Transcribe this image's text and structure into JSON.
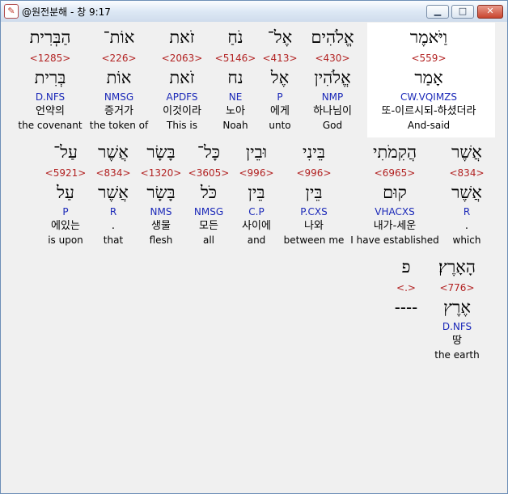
{
  "window": {
    "title": "@원전분해 - 창 9:17",
    "min": "▁",
    "max": "□",
    "close": "✕"
  },
  "rows": [
    [
      {
        "heb": "וַיֹּאמֶר",
        "strong": "<559>",
        "lemma": "אָמַר",
        "morph": "CW.VQIMZS",
        "kor": "또-이르시되-하셨더라",
        "eng": "And-said",
        "highlight": true
      },
      {
        "heb": "אֱלֹהִים",
        "strong": "<430>",
        "lemma": "אֱלֹהִין",
        "morph": "NMP",
        "kor": "하나님이",
        "eng": "God"
      },
      {
        "heb": "אֶל־",
        "strong": "<413>",
        "lemma": "אֶל",
        "morph": "P",
        "kor": "에게",
        "eng": "unto"
      },
      {
        "heb": "נֹחַ",
        "strong": "<5146>",
        "lemma": "נח",
        "morph": "NE",
        "kor": "노아",
        "eng": "Noah"
      },
      {
        "heb": "זֹאת",
        "strong": "<2063>",
        "lemma": "זֹאת",
        "morph": "APDFS",
        "kor": "이것이라",
        "eng": "This is"
      },
      {
        "heb": "אוֹת־",
        "strong": "<226>",
        "lemma": "אוֹת",
        "morph": "NMSG",
        "kor": "증거가",
        "eng": "the token of"
      },
      {
        "heb": "הַבְּרִית",
        "strong": "<1285>",
        "lemma": "בְּרִית",
        "morph": "D.NFS",
        "kor": "언약의",
        "eng": "the covenant"
      }
    ],
    [
      {
        "heb": "אֲשֶׁר",
        "strong": "<834>",
        "lemma": "אֲשֶׁר",
        "morph": "R",
        "kor": ".",
        "eng": "which"
      },
      {
        "heb": "הֲקִמֹתִי",
        "strong": "<6965>",
        "lemma": "קוּם",
        "morph": "VHACXS",
        "kor": "내가-세운",
        "eng": "I have established"
      },
      {
        "heb": "בֵּינִי",
        "strong": "<996>",
        "lemma": "בֵּין",
        "morph": "P.CXS",
        "kor": "나와",
        "eng": "between me"
      },
      {
        "heb": "וּבֵין",
        "strong": "<996>",
        "lemma": "בֵּין",
        "morph": "C.P",
        "kor": "사이에",
        "eng": "and"
      },
      {
        "heb": "כָּל־",
        "strong": "<3605>",
        "lemma": "כֹּל",
        "morph": "NMSG",
        "kor": "모든",
        "eng": "all"
      },
      {
        "heb": "בָּשָׂר",
        "strong": "<1320>",
        "lemma": "בָּשָׂר",
        "morph": "NMS",
        "kor": "생물",
        "eng": "flesh"
      },
      {
        "heb": "אֲשֶׁר",
        "strong": "<834>",
        "lemma": "אֲשֶׁר",
        "morph": "R",
        "kor": ".",
        "eng": "that"
      },
      {
        "heb": "עַל־",
        "strong": "<5921>",
        "lemma": "עַל",
        "morph": "P",
        "kor": "에있는",
        "eng": "is upon"
      }
    ],
    [
      {
        "heb": "הָאָרֶץ׃",
        "strong": "<776>",
        "lemma": "אֶרֶץ",
        "morph": "D.NFS",
        "kor": "땅",
        "eng": "the earth"
      },
      {
        "heb": "פ",
        "strong": "<.>",
        "lemma": "----",
        "morph": "",
        "kor": "",
        "eng": ""
      }
    ]
  ]
}
